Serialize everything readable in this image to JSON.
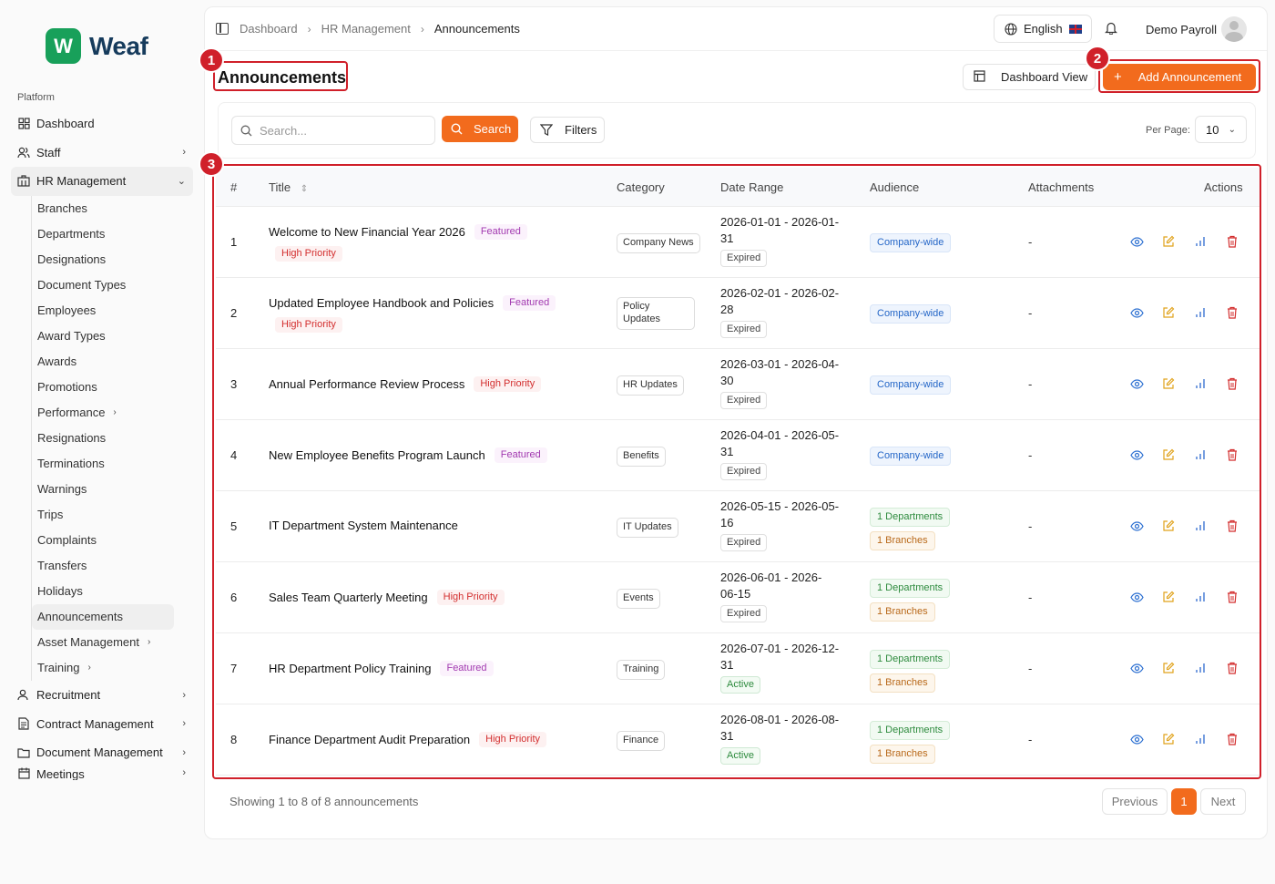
{
  "brand": {
    "mark": "W",
    "name": "Weaf"
  },
  "sidebar": {
    "section_label": "Platform",
    "items": [
      {
        "label": "Dashboard",
        "icon": "grid-icon"
      },
      {
        "label": "Staff",
        "icon": "users-icon"
      },
      {
        "label": "HR Management",
        "icon": "building-icon"
      }
    ],
    "hr_sub": [
      "Branches",
      "Departments",
      "Designations",
      "Document Types",
      "Employees",
      "Award Types",
      "Awards",
      "Promotions",
      "Performance",
      "Resignations",
      "Terminations",
      "Warnings",
      "Trips",
      "Complaints",
      "Transfers",
      "Holidays",
      "Announcements",
      "Asset Management",
      "Training"
    ],
    "bottom_items": [
      {
        "label": "Recruitment"
      },
      {
        "label": "Contract Management"
      },
      {
        "label": "Document Management"
      },
      {
        "label": "Meetings"
      }
    ]
  },
  "header": {
    "breadcrumb": [
      "Dashboard",
      "HR Management",
      "Announcements"
    ],
    "language": "English",
    "user": "Demo Payroll"
  },
  "page": {
    "title": "Announcements",
    "dashboard_view_label": "Dashboard View",
    "add_label": "Add Announcement"
  },
  "filters": {
    "search_placeholder": "Search...",
    "search_label": "Search",
    "filters_label": "Filters",
    "per_page_label": "Per Page:",
    "per_page_value": "10"
  },
  "table": {
    "headers": [
      "#",
      "Title",
      "Category",
      "Date Range",
      "Audience",
      "Attachments",
      "Actions"
    ],
    "rows": [
      {
        "n": "1",
        "title": "Welcome to New Financial Year 2026",
        "featured": "Featured",
        "priority": "High Priority",
        "category": "Company News",
        "date1": "2026-01-01 - 2026-01-",
        "date2": "31",
        "status": "Expired",
        "aud1": "Company-wide",
        "aud2": "",
        "attach": "-"
      },
      {
        "n": "2",
        "title": "Updated Employee Handbook and Policies",
        "featured": "Featured",
        "priority": "High Priority",
        "category": "Policy Updates",
        "date1": "2026-02-01 - 2026-02-",
        "date2": "28",
        "status": "Expired",
        "aud1": "Company-wide",
        "aud2": "",
        "attach": "-"
      },
      {
        "n": "3",
        "title": "Annual Performance Review Process",
        "featured": "",
        "priority": "High Priority",
        "category": "HR Updates",
        "date1": "2026-03-01 - 2026-04-",
        "date2": "30",
        "status": "Expired",
        "aud1": "Company-wide",
        "aud2": "",
        "attach": "-"
      },
      {
        "n": "4",
        "title": "New Employee Benefits Program Launch",
        "featured": "Featured",
        "priority": "",
        "category": "Benefits",
        "date1": "2026-04-01 - 2026-05-",
        "date2": "31",
        "status": "Expired",
        "aud1": "Company-wide",
        "aud2": "",
        "attach": "-"
      },
      {
        "n": "5",
        "title": "IT Department System Maintenance",
        "featured": "",
        "priority": "",
        "category": "IT Updates",
        "date1": "2026-05-15 - 2026-05-",
        "date2": "16",
        "status": "Expired",
        "aud1": "1 Departments",
        "aud2": "1 Branches",
        "attach": "-"
      },
      {
        "n": "6",
        "title": "Sales Team Quarterly Meeting",
        "featured": "",
        "priority": "High Priority",
        "category": "Events",
        "date1": "2026-06-01 - 2026-",
        "date2": "06-15",
        "status": "Expired",
        "aud1": "1 Departments",
        "aud2": "1 Branches",
        "attach": "-"
      },
      {
        "n": "7",
        "title": "HR Department Policy Training",
        "featured": "Featured",
        "priority": "",
        "category": "Training",
        "date1": "2026-07-01 - 2026-12-",
        "date2": "31",
        "status": "Active",
        "aud1": "1 Departments",
        "aud2": "1 Branches",
        "attach": "-"
      },
      {
        "n": "8",
        "title": "Finance Department Audit Preparation",
        "featured": "",
        "priority": "High Priority",
        "category": "Finance",
        "date1": "2026-08-01 - 2026-08-",
        "date2": "31",
        "status": "Active",
        "aud1": "1 Departments",
        "aud2": "1 Branches",
        "attach": "-"
      }
    ]
  },
  "footer": {
    "showing": "Showing 1 to 8 of 8 announcements",
    "prev": "Previous",
    "page": "1",
    "next": "Next"
  },
  "callouts": [
    "1",
    "2",
    "3"
  ],
  "colors": {
    "accent": "#f26b1d",
    "brand_green": "#18a05a",
    "callout_red": "#d0202a"
  }
}
